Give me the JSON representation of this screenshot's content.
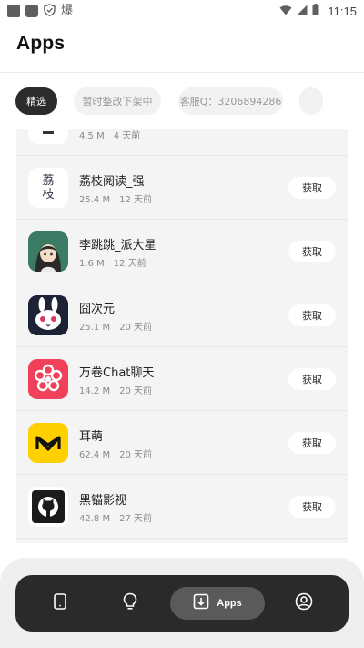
{
  "status_bar": {
    "time": "11:15",
    "left_icons": [
      "notification-square-icon",
      "notification-square-icon",
      "shield-icon",
      "app-glyph-icon"
    ],
    "app_glyph": "爆",
    "right_icons": [
      "wifi-icon",
      "signal-icon",
      "battery-icon"
    ]
  },
  "header": {
    "title": "Apps"
  },
  "chips": [
    {
      "label": "精选",
      "active": true
    },
    {
      "label": "暂时整改下架中",
      "active": false
    },
    {
      "label": "客服Q：3206894286",
      "active": false
    },
    {
      "label": "",
      "active": false
    }
  ],
  "apps": [
    {
      "name": "",
      "size": "4.5 M",
      "date": "4 天前",
      "button": "",
      "icon": "book-icon",
      "partial": true
    },
    {
      "name": "荔枝阅读_强",
      "size": "25.4 M",
      "date": "12 天前",
      "button": "获取",
      "icon": "lizhi-reader-icon",
      "icon_text": "荔枝"
    },
    {
      "name": "李跳跳_派大星",
      "size": "1.6 M",
      "date": "12 天前",
      "button": "获取",
      "icon": "anime-girl-icon"
    },
    {
      "name": "囧次元",
      "size": "25.1 M",
      "date": "20 天前",
      "button": "获取",
      "icon": "rabbit-face-icon"
    },
    {
      "name": "万卷Chat聊天",
      "size": "14.2 M",
      "date": "20 天前",
      "button": "获取",
      "icon": "flower-icon"
    },
    {
      "name": "耳萌",
      "size": "62.4 M",
      "date": "20 天前",
      "button": "获取",
      "icon": "ermeng-logo-icon"
    },
    {
      "name": "黑锚影视",
      "size": "42.8 M",
      "date": "27 天前",
      "button": "获取",
      "icon": "github-icon"
    }
  ],
  "bottom_nav": {
    "items": [
      {
        "icon": "phone-icon",
        "label": ""
      },
      {
        "icon": "lightbulb-icon",
        "label": ""
      },
      {
        "icon": "download-icon",
        "label": "Apps",
        "active": true
      },
      {
        "icon": "profile-icon",
        "label": ""
      }
    ]
  },
  "colors": {
    "accent_dark": "#2a2a2a",
    "nav_active": "#5a5a5a",
    "list_bg": "#f4f4f4",
    "icon_red": "#f0405a",
    "icon_yellow": "#ffd000"
  }
}
